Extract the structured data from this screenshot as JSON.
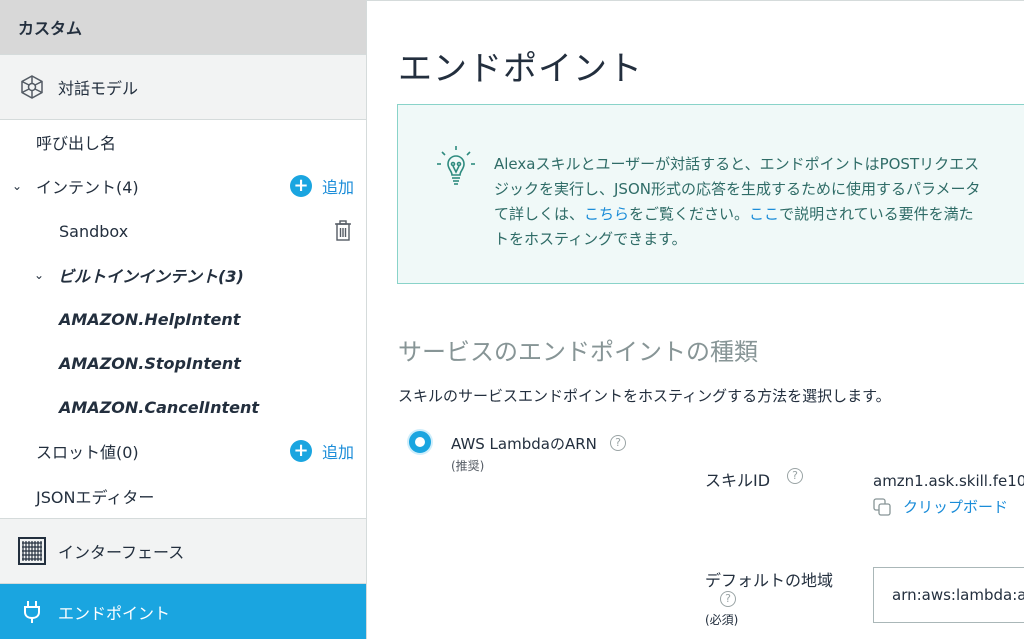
{
  "sidebar": {
    "header": "カスタム",
    "interaction_model": "対話モデル",
    "invocation": "呼び出し名",
    "intents": {
      "label": "インテント(4)",
      "add": "追加"
    },
    "sandbox": "Sandbox",
    "builtin": "ビルトインインテント(3)",
    "builtin_items": [
      "AMAZON.HelpIntent",
      "AMAZON.StopIntent",
      "AMAZON.CancelIntent"
    ],
    "slots": {
      "label": "スロット値(0)",
      "add": "追加"
    },
    "json_editor": "JSONエディター",
    "interfaces": "インターフェース",
    "endpoint": "エンドポイント"
  },
  "main": {
    "title": "エンドポイント",
    "info": {
      "line1": "AlexaスキルとユーザーがE対話すると、エンドポイントはPOSTリクエス",
      "line2": "ジックを実行し、JSON形式の応答を生成するために使用するパラメータ",
      "line3a": "て詳しくは、",
      "link1": "こちら",
      "line3b": "をご覧ください。",
      "link2": "ここ",
      "line3c": "で説明されている要件を満た",
      "line4": "トをホスティングできます。"
    },
    "section_title": "サービスのエンドポイントの種類",
    "section_desc": "スキルのサービスエンドポイントをホスティングする方法を選択します。",
    "option_label": "AWS LambdaのARN",
    "option_sub": "(推奨)",
    "skill_id_label": "スキルID",
    "skill_id_value": "amzn1.ask.skill.fe100",
    "copy_label": "クリップボード",
    "region_label": "デフォルトの地域",
    "region_required": "(必須)",
    "arn_value": "arn:aws:lambda:a"
  },
  "colors": {
    "accent": "#1aa5e0",
    "info_bg": "#f0f9f8",
    "info_border": "#89d3c9"
  }
}
